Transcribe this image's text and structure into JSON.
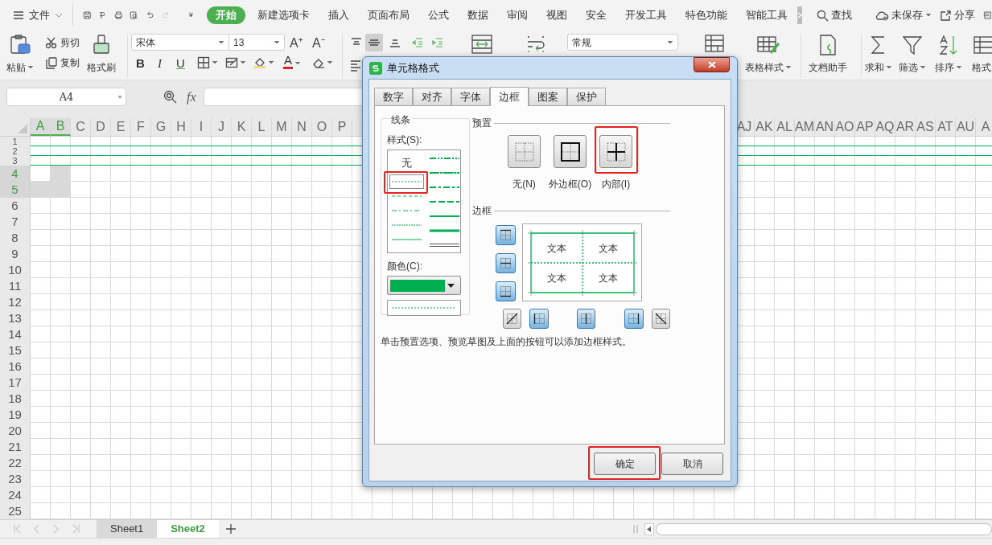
{
  "menu": {
    "file": "文件",
    "tabs": [
      {
        "label": "开始",
        "selected": true
      },
      {
        "label": "新建选项卡",
        "selected": false
      },
      {
        "label": "插入",
        "selected": false
      },
      {
        "label": "页面布局",
        "selected": false
      },
      {
        "label": "公式",
        "selected": false
      },
      {
        "label": "数据",
        "selected": false
      },
      {
        "label": "审阅",
        "selected": false
      },
      {
        "label": "视图",
        "selected": false
      },
      {
        "label": "安全",
        "selected": false
      },
      {
        "label": "开发工具",
        "selected": false
      },
      {
        "label": "特色功能",
        "selected": false
      },
      {
        "label": "智能工具",
        "selected": false
      }
    ],
    "search": "查找",
    "save_status": "未保存",
    "share": "分享"
  },
  "ribbon": {
    "paste": "粘贴",
    "cut": "剪切",
    "copy": "复制",
    "format_painter": "格式刷",
    "font": "宋体",
    "font_size": "13",
    "grow_font": "A⁺",
    "shrink_font": "A⁻",
    "bold": "B",
    "italic": "I",
    "underline": "U",
    "font_color": "A",
    "number_format": "常规",
    "table_style": "表格样式",
    "doc_assistant": "文档助手",
    "sum": "求和",
    "filter": "筛选",
    "sort": "排序",
    "format": "格式"
  },
  "formula_bar": {
    "name_box": "A4",
    "fx": "fx"
  },
  "sheet": {
    "columns_left": [
      {
        "label": "A",
        "selected": true
      },
      {
        "label": "B",
        "selected": true
      },
      {
        "label": "C",
        "selected": false
      },
      {
        "label": "D",
        "selected": false
      },
      {
        "label": "E",
        "selected": false
      },
      {
        "label": "F",
        "selected": false
      },
      {
        "label": "G",
        "selected": false
      },
      {
        "label": "H",
        "selected": false
      },
      {
        "label": "I",
        "selected": false
      },
      {
        "label": "J",
        "selected": false
      },
      {
        "label": "K",
        "selected": false
      },
      {
        "label": "L",
        "selected": false
      },
      {
        "label": "M",
        "selected": false
      },
      {
        "label": "N",
        "selected": false
      },
      {
        "label": "O",
        "selected": false
      },
      {
        "label": "P",
        "selected": false
      }
    ],
    "columns_right": [
      {
        "label": "AJ",
        "selected": false
      },
      {
        "label": "AK",
        "selected": false
      },
      {
        "label": "AL",
        "selected": false
      },
      {
        "label": "AM",
        "selected": false
      },
      {
        "label": "AN",
        "selected": false
      },
      {
        "label": "AO",
        "selected": false
      },
      {
        "label": "AP",
        "selected": false
      },
      {
        "label": "AQ",
        "selected": false
      },
      {
        "label": "AR",
        "selected": false
      },
      {
        "label": "AS",
        "selected": false
      },
      {
        "label": "AT",
        "selected": false
      },
      {
        "label": "AU",
        "selected": false
      },
      {
        "label": "A",
        "selected": false
      }
    ],
    "rows": [
      {
        "label": "1",
        "kind": "short",
        "bordered": true,
        "selected": false
      },
      {
        "label": "2",
        "kind": "short",
        "bordered": true,
        "selected": false
      },
      {
        "label": "3",
        "kind": "short",
        "bordered": true,
        "selected": false
      },
      {
        "label": "4",
        "kind": "normal",
        "bordered": false,
        "selected": true
      },
      {
        "label": "5",
        "kind": "normal",
        "bordered": false,
        "selected": true
      },
      {
        "label": "6",
        "kind": "normal",
        "bordered": false,
        "selected": false
      },
      {
        "label": "7",
        "kind": "normal",
        "bordered": false,
        "selected": false
      },
      {
        "label": "8",
        "kind": "normal",
        "bordered": false,
        "selected": false
      },
      {
        "label": "9",
        "kind": "normal",
        "bordered": false,
        "selected": false
      },
      {
        "label": "10",
        "kind": "normal",
        "bordered": false,
        "selected": false
      },
      {
        "label": "11",
        "kind": "normal",
        "bordered": false,
        "selected": false
      },
      {
        "label": "12",
        "kind": "normal",
        "bordered": false,
        "selected": false
      },
      {
        "label": "13",
        "kind": "normal",
        "bordered": false,
        "selected": false
      },
      {
        "label": "14",
        "kind": "normal",
        "bordered": false,
        "selected": false
      },
      {
        "label": "15",
        "kind": "normal",
        "bordered": false,
        "selected": false
      },
      {
        "label": "16",
        "kind": "normal",
        "bordered": false,
        "selected": false
      },
      {
        "label": "17",
        "kind": "normal",
        "bordered": false,
        "selected": false
      },
      {
        "label": "18",
        "kind": "normal",
        "bordered": false,
        "selected": false
      },
      {
        "label": "19",
        "kind": "normal",
        "bordered": false,
        "selected": false
      },
      {
        "label": "20",
        "kind": "normal",
        "bordered": false,
        "selected": false
      },
      {
        "label": "21",
        "kind": "normal",
        "bordered": false,
        "selected": false
      },
      {
        "label": "22",
        "kind": "normal",
        "bordered": false,
        "selected": false
      },
      {
        "label": "23",
        "kind": "normal",
        "bordered": false,
        "selected": false
      },
      {
        "label": "24",
        "kind": "normal",
        "bordered": false,
        "selected": false
      },
      {
        "label": "25",
        "kind": "normal",
        "bordered": false,
        "selected": false
      }
    ]
  },
  "dialog": {
    "title": "单元格格式",
    "tabs": [
      {
        "label": "数字",
        "selected": false
      },
      {
        "label": "对齐",
        "selected": false
      },
      {
        "label": "字体",
        "selected": false
      },
      {
        "label": "边框",
        "selected": true
      },
      {
        "label": "图案",
        "selected": false
      },
      {
        "label": "保护",
        "selected": false
      }
    ],
    "line_group": {
      "title": "线条",
      "style_label": "样式(S):",
      "style_columns": [
        [
          {
            "kind": "none",
            "label": "无",
            "selected": false,
            "highlighted": false
          },
          {
            "kind": "dotted",
            "selected": true,
            "highlighted": true
          },
          {
            "kind": "dashed",
            "selected": false,
            "highlighted": false
          },
          {
            "kind": "dashdot",
            "selected": false,
            "highlighted": false
          },
          {
            "kind": "hair",
            "selected": false,
            "highlighted": false
          },
          {
            "kind": "thin",
            "selected": false,
            "highlighted": false
          }
        ],
        [
          {
            "kind": "medium-dashdotdot",
            "selected": false,
            "highlighted": false
          },
          {
            "kind": "slant-dashdot",
            "selected": false,
            "highlighted": false
          },
          {
            "kind": "medium-dashdot",
            "selected": false,
            "highlighted": false
          },
          {
            "kind": "medium-dashed",
            "selected": false,
            "highlighted": false
          },
          {
            "kind": "medium",
            "selected": false,
            "highlighted": false
          },
          {
            "kind": "thick",
            "selected": false,
            "highlighted": false
          },
          {
            "kind": "double",
            "selected": false,
            "highlighted": false
          }
        ]
      ],
      "color_label": "颜色(C):",
      "color": "#00b050"
    },
    "preset_title": "预置",
    "presets": [
      {
        "kind": "none",
        "label": "无(N)",
        "highlighted": false
      },
      {
        "kind": "outline",
        "label": "外边框(O)",
        "highlighted": false
      },
      {
        "kind": "inside",
        "label": "内部(I)",
        "highlighted": true
      }
    ],
    "border_title": "边框",
    "side_buttons": [
      {
        "kind": "top",
        "pressed": true
      },
      {
        "kind": "middle",
        "pressed": true
      },
      {
        "kind": "bottom",
        "pressed": true
      }
    ],
    "bottom_buttons": [
      {
        "kind": "diagonal-up",
        "pressed": false
      },
      {
        "kind": "left",
        "pressed": true
      },
      {
        "kind": "center",
        "pressed": true
      },
      {
        "kind": "right",
        "pressed": true
      },
      {
        "kind": "diagonal-down",
        "pressed": false
      }
    ],
    "preview_texts": [
      "文本",
      "文本",
      "文本",
      "文本"
    ],
    "hint": "单击预置选项、预览草图及上面的按钮可以添加边框样式。",
    "buttons": [
      {
        "label": "确定",
        "highlighted": true
      },
      {
        "label": "取消",
        "highlighted": false
      }
    ]
  },
  "sheet_tabs": [
    {
      "label": "Sheet1",
      "selected": false
    },
    {
      "label": "Sheet2",
      "selected": true
    }
  ]
}
